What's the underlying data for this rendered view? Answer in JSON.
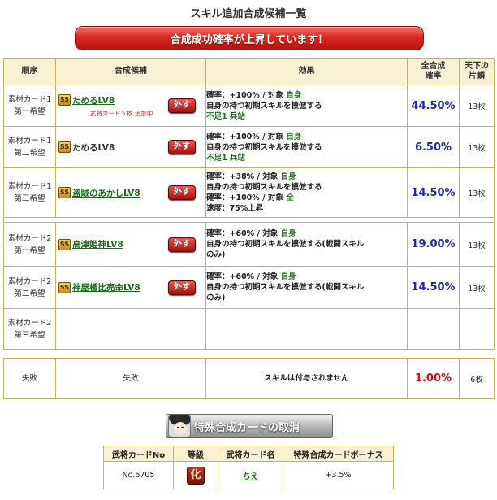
{
  "page_title": "スキル追加合成候補一覧",
  "banner": "合成成功確率が上昇しています！",
  "headers": {
    "order": "順序",
    "candidate": "合成候補",
    "effect": "効果",
    "rate_line1": "全合成",
    "rate_line2": "確率",
    "stock_line1": "天下の",
    "stock_line2": "片鱗"
  },
  "remove_label": "外す",
  "ss_badge": "SS",
  "card1": [
    {
      "order1": "素材カード1",
      "order2": "第一希望",
      "skill": "ためるLV8",
      "link": true,
      "note": "武将カード５枚 追加中",
      "effect": [
        [
          {
            "t": "確率：+100% / 対象 "
          },
          {
            "t": "自身",
            "c": "g"
          }
        ],
        [
          {
            "t": "自身の持つ初期スキルを模倣する"
          }
        ],
        [
          {
            "t": "不足1 兵站",
            "c": "gb"
          }
        ]
      ],
      "rate": "44.50%",
      "stock": "13枚"
    },
    {
      "order1": "素材カード1",
      "order2": "第二希望",
      "skill": "ためるLV8",
      "link": false,
      "note": "",
      "effect": [
        [
          {
            "t": "確率：+100% / 対象 "
          },
          {
            "t": "自身",
            "c": "g"
          }
        ],
        [
          {
            "t": "自身の持つ初期スキルを模倣する"
          }
        ],
        [
          {
            "t": "不足1 兵站",
            "c": "gb"
          }
        ]
      ],
      "rate": "6.50%",
      "stock": "13枚"
    },
    {
      "order1": "素材カード1",
      "order2": "第三希望",
      "skill": "盗賊のあかしLV8",
      "link": true,
      "note": "",
      "effect": [
        [
          {
            "t": "確率：+38% / 対象 "
          },
          {
            "t": "自身",
            "c": "g"
          }
        ],
        [
          {
            "t": "自身の持つ初期スキルを模倣する"
          }
        ],
        [
          {
            "t": "確率：+100% / 対象 "
          },
          {
            "t": "全",
            "c": "g"
          }
        ],
        [
          {
            "t": "速度：75%上昇"
          }
        ]
      ],
      "rate": "14.50%",
      "stock": "13枚"
    }
  ],
  "card2": [
    {
      "order1": "素材カード2",
      "order2": "第一希望",
      "skill": "高津姫神LV8",
      "link": true,
      "note": "",
      "effect": [
        [
          {
            "t": "確率：+60% / 対象 "
          },
          {
            "t": "自身",
            "c": "g"
          }
        ],
        [
          {
            "t": "自身の持つ初期スキルを模倣する(戦闘スキル"
          }
        ],
        [
          {
            "t": "のみ)"
          }
        ]
      ],
      "rate": "19.00%",
      "stock": "13枚"
    },
    {
      "order1": "素材カード2",
      "order2": "第二希望",
      "skill": "神屋楯比売命LV8",
      "link": true,
      "note": "",
      "effect": [
        [
          {
            "t": "確率：+60% / 対象 "
          },
          {
            "t": "自身",
            "c": "g"
          }
        ],
        [
          {
            "t": "自身の持つ初期スキルを模倣する(戦闘スキル"
          }
        ],
        [
          {
            "t": "のみ)"
          }
        ]
      ],
      "rate": "14.50%",
      "stock": "13枚"
    },
    {
      "order1": "素材カード2",
      "order2": "第三希望",
      "skill": "",
      "link": false,
      "note": "",
      "effect": [],
      "rate": "",
      "stock": ""
    }
  ],
  "fail": {
    "order": "失敗",
    "candidate": "失敗",
    "effect": "スキルは付与されません",
    "rate": "1.00%",
    "stock": "6枚"
  },
  "cancel_button": "特殊合成カードの取消",
  "bonus_table": {
    "headers": [
      "武将カードNo",
      "等級",
      "武将カード名",
      "特殊合成カードボーナス"
    ],
    "row": {
      "card_no": "No.6705",
      "grade": "化",
      "name": "ちえ",
      "bonus": "+3.5%"
    }
  },
  "colors": {
    "banner_red": "#d92a24",
    "rate_blue": "#1e28a8",
    "rate_red": "#d01010",
    "link_green": "#1c6b1c",
    "border_gold": "#c8b06a"
  }
}
